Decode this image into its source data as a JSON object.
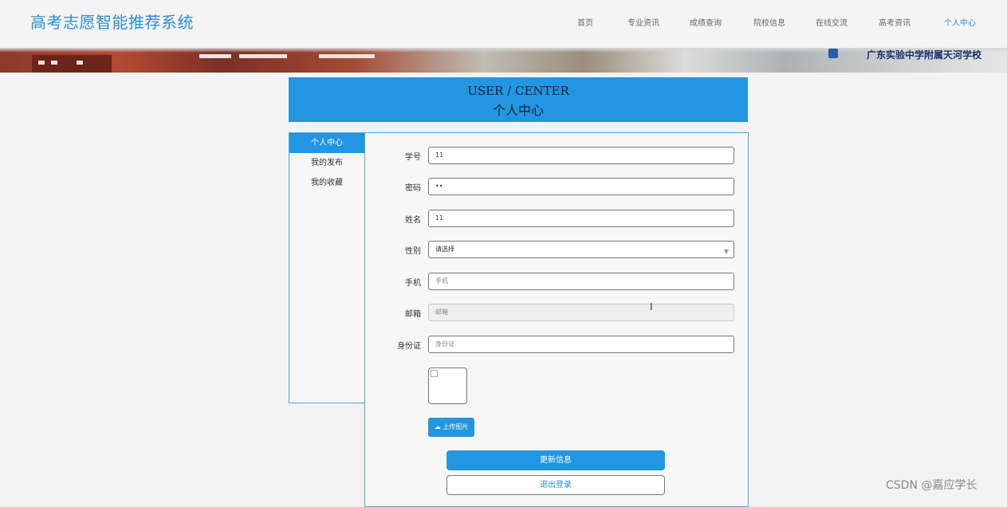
{
  "header": {
    "logo": "高考志愿智能推荐系统",
    "nav": [
      "首页",
      "专业资讯",
      "成绩查询",
      "院校信息",
      "在线交流",
      "高考资讯",
      "个人中心"
    ],
    "active_nav": "个人中心"
  },
  "banner": {
    "school_name": "广东实验中学附属天河学校"
  },
  "page_title": {
    "en": "USER / CENTER",
    "cn": "个人中心"
  },
  "sidebar": {
    "items": [
      "个人中心",
      "我的发布",
      "我的收藏"
    ],
    "active": "个人中心"
  },
  "form": {
    "student_id": {
      "label": "学号",
      "value": "11"
    },
    "password": {
      "label": "密码",
      "value": "••"
    },
    "name": {
      "label": "姓名",
      "value": "11"
    },
    "gender": {
      "label": "性别",
      "value": "请选择"
    },
    "phone": {
      "label": "手机",
      "placeholder": "手机"
    },
    "email": {
      "label": "邮箱",
      "placeholder": "邮箱"
    },
    "id_card": {
      "label": "身份证",
      "placeholder": "身份证"
    },
    "upload_label": "上传图片",
    "update_label": "更新信息",
    "logout_label": "退出登录"
  },
  "watermark": "CSDN @嘉应学长",
  "colors": {
    "accent": "#2296e0",
    "logo": "#2a8fd6"
  }
}
